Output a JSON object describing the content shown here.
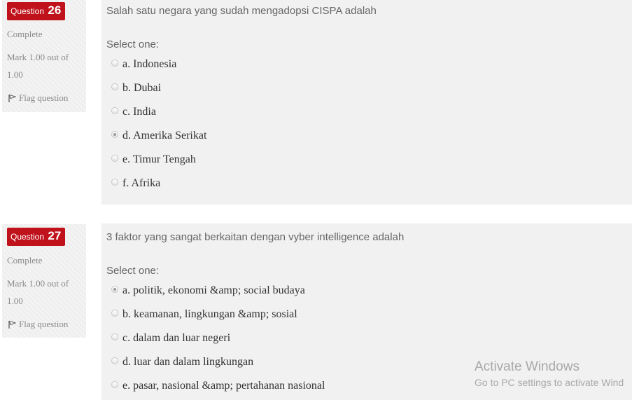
{
  "questions": [
    {
      "label": "Question",
      "number": "26",
      "state": "Complete",
      "grade_line1": "Mark 1.00 out of",
      "grade_line2": "1.00",
      "flag_label": "Flag question",
      "text": "Salah satu negara yang sudah mengadopsi CISPA adalah",
      "prompt": "Select one:",
      "options": [
        {
          "label": "a. Indonesia",
          "checked": false
        },
        {
          "label": "b. Dubai",
          "checked": false
        },
        {
          "label": "c. India",
          "checked": false
        },
        {
          "label": "d. Amerika Serikat",
          "checked": true
        },
        {
          "label": "e. Timur Tengah",
          "checked": false
        },
        {
          "label": "f. Afrika",
          "checked": false
        }
      ]
    },
    {
      "label": "Question",
      "number": "27",
      "state": "Complete",
      "grade_line1": "Mark 1.00 out of",
      "grade_line2": "1.00",
      "flag_label": "Flag question",
      "text": "3 faktor yang sangat berkaitan dengan vyber intelligence adalah",
      "prompt": "Select one:",
      "options": [
        {
          "label": "a. politik, ekonomi &amp; social budaya",
          "checked": true
        },
        {
          "label": "b. keamanan, lingkungan &amp; sosial",
          "checked": false
        },
        {
          "label": "c. dalam dan luar negeri",
          "checked": false
        },
        {
          "label": "d. luar dan dalam lingkungan",
          "checked": false
        },
        {
          "label": "e. pasar, nasional &amp; pertahanan nasional",
          "checked": false
        }
      ]
    }
  ],
  "watermark": {
    "line1": "Activate Windows",
    "line2": "Go to PC settings to activate Wind"
  }
}
